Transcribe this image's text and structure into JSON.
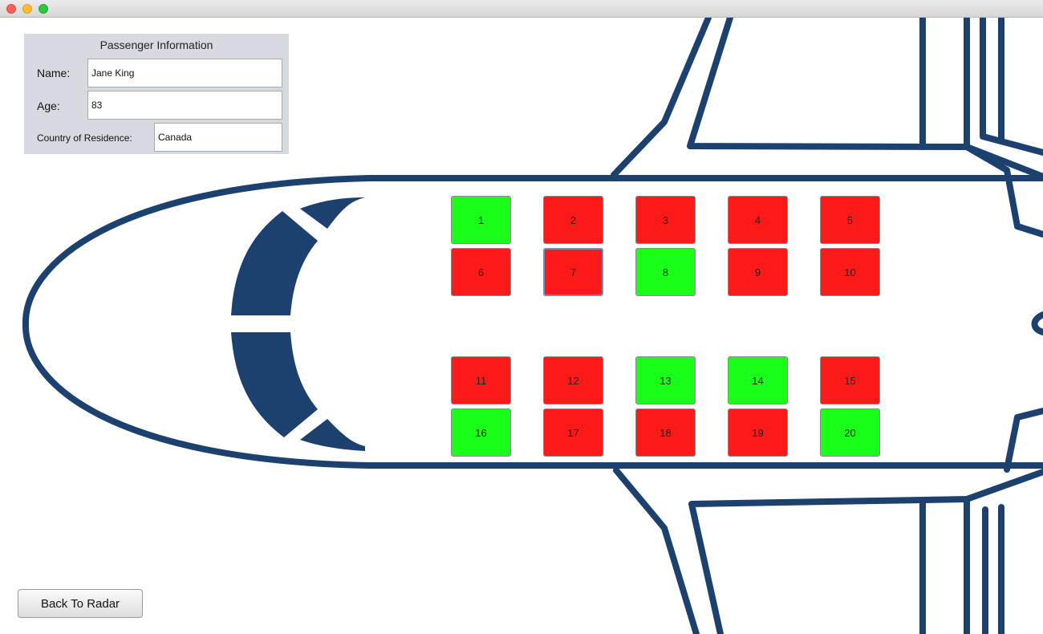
{
  "window": {
    "controls": [
      "close",
      "minimize",
      "maximize"
    ],
    "colors": {
      "close": "#fc5f57",
      "minimize": "#fdbc2e",
      "maximize": "#29c940"
    }
  },
  "passenger_panel": {
    "title": "Passenger Information",
    "name_label": "Name:",
    "name_value": "Jane King",
    "age_label": "Age:",
    "age_value": "83",
    "country_label": "Country of Residence:",
    "country_value": "Canada"
  },
  "seats": [
    {
      "number": "1",
      "status": "available"
    },
    {
      "number": "2",
      "status": "occupied"
    },
    {
      "number": "3",
      "status": "occupied"
    },
    {
      "number": "4",
      "status": "occupied"
    },
    {
      "number": "5",
      "status": "occupied"
    },
    {
      "number": "6",
      "status": "occupied"
    },
    {
      "number": "7",
      "status": "occupied",
      "selected": true
    },
    {
      "number": "8",
      "status": "available"
    },
    {
      "number": "9",
      "status": "occupied"
    },
    {
      "number": "10",
      "status": "occupied"
    },
    {
      "number": "11",
      "status": "occupied"
    },
    {
      "number": "12",
      "status": "occupied"
    },
    {
      "number": "13",
      "status": "available"
    },
    {
      "number": "14",
      "status": "available"
    },
    {
      "number": "15",
      "status": "occupied"
    },
    {
      "number": "16",
      "status": "available"
    },
    {
      "number": "17",
      "status": "occupied"
    },
    {
      "number": "18",
      "status": "occupied"
    },
    {
      "number": "19",
      "status": "occupied"
    },
    {
      "number": "20",
      "status": "available"
    }
  ],
  "colors": {
    "available": "#19fe19",
    "occupied": "#fe1919",
    "plane_outline": "#1c416f",
    "panel_bg": "#d7dae0"
  },
  "back_button": {
    "label": "Back To Radar"
  }
}
